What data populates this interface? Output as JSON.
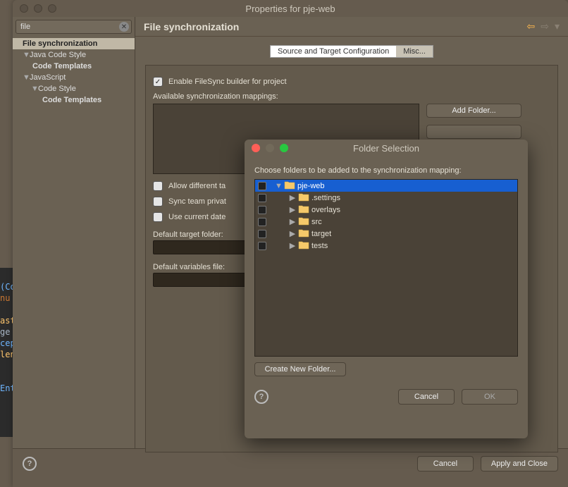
{
  "window": {
    "title": "Properties for pje-web"
  },
  "filter": {
    "value": "file"
  },
  "tree": [
    {
      "label": "File synchronization",
      "indent": 14,
      "selected": true
    },
    {
      "label": "Java Code Style",
      "indent": 14,
      "arrow": true
    },
    {
      "label": "Code Templates",
      "indent": 28,
      "bold": true
    },
    {
      "label": "JavaScript",
      "indent": 14,
      "arrow": true
    },
    {
      "label": "Code Style",
      "indent": 26,
      "arrow": true
    },
    {
      "label": "Code Templates",
      "indent": 42,
      "bold": true
    }
  ],
  "section": {
    "title": "File synchronization"
  },
  "tabs": {
    "selected": "Source and Target Configuration",
    "other": "Misc..."
  },
  "form": {
    "enable": {
      "label": "Enable FileSync builder for project",
      "checked": true
    },
    "available_label": "Available synchronization mappings:",
    "add_folder": "Add Folder...",
    "allow_diff": {
      "label": "Allow different ta",
      "checked": false
    },
    "sync_team": {
      "label": "Sync team privat",
      "checked": false
    },
    "use_date": {
      "label": "Use current date",
      "checked": false
    },
    "default_target_label": "Default target folder:",
    "default_vars_label": "Default variables file:"
  },
  "bottom": {
    "cancel": "Cancel",
    "apply": "Apply and Close"
  },
  "dialog": {
    "title": "Folder Selection",
    "prompt": "Choose folders to be added to the synchronization mapping:",
    "items": [
      {
        "name": "pje-web",
        "indent": 0,
        "open": true,
        "selected": true
      },
      {
        "name": ".settings",
        "indent": 1
      },
      {
        "name": "overlays",
        "indent": 1
      },
      {
        "name": "src",
        "indent": 1
      },
      {
        "name": "target",
        "indent": 1
      },
      {
        "name": "tests",
        "indent": 1
      }
    ],
    "create": "Create New Folder...",
    "cancel": "Cancel",
    "ok": "OK"
  },
  "editor_frag": [
    "(Co",
    "nu",
    "",
    "ast",
    "ge",
    "cep",
    "len",
    "",
    "",
    "Ent"
  ]
}
